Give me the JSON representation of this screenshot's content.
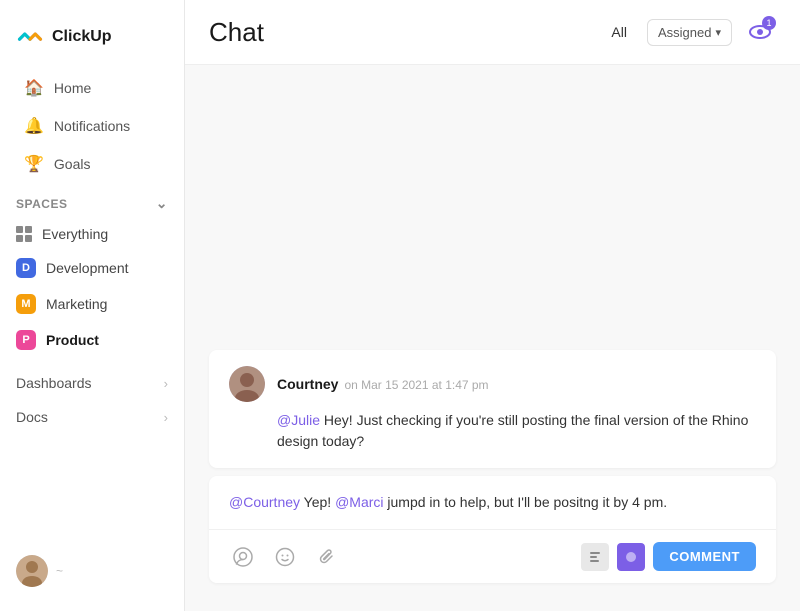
{
  "app": {
    "name": "ClickUp"
  },
  "sidebar": {
    "nav_items": [
      {
        "id": "home",
        "label": "Home",
        "icon": "home"
      },
      {
        "id": "notifications",
        "label": "Notifications",
        "icon": "bell"
      },
      {
        "id": "goals",
        "label": "Goals",
        "icon": "trophy"
      }
    ],
    "spaces_label": "Spaces",
    "spaces": [
      {
        "id": "everything",
        "label": "Everything",
        "type": "grid"
      },
      {
        "id": "development",
        "label": "Development",
        "badge": "D",
        "color": "dev"
      },
      {
        "id": "marketing",
        "label": "Marketing",
        "badge": "M",
        "color": "mkt"
      },
      {
        "id": "product",
        "label": "Product",
        "badge": "P",
        "color": "prod",
        "bold": true
      }
    ],
    "bottom_items": [
      {
        "id": "dashboards",
        "label": "Dashboards"
      },
      {
        "id": "docs",
        "label": "Docs"
      }
    ],
    "avatar_initial": "~"
  },
  "header": {
    "title": "Chat",
    "filter_all": "All",
    "filter_assigned": "Assigned",
    "notification_count": "1"
  },
  "messages": [
    {
      "id": "msg1",
      "author": "Courtney",
      "timestamp": "on Mar 15 2021 at 1:47 pm",
      "body_prefix": "@Julie",
      "body": " Hey! Just checking if you're still posting the final version of the Rhino design today?"
    }
  ],
  "reply": {
    "body_part1": "@Courtney",
    "body_middle": " Yep! ",
    "body_part2": "@Marci",
    "body_end": " jumpd in to help, but I'll be positng it by 4 pm."
  },
  "compose": {
    "comment_label": "COMMENT",
    "tools": [
      "person",
      "emoji",
      "paperclip"
    ]
  }
}
